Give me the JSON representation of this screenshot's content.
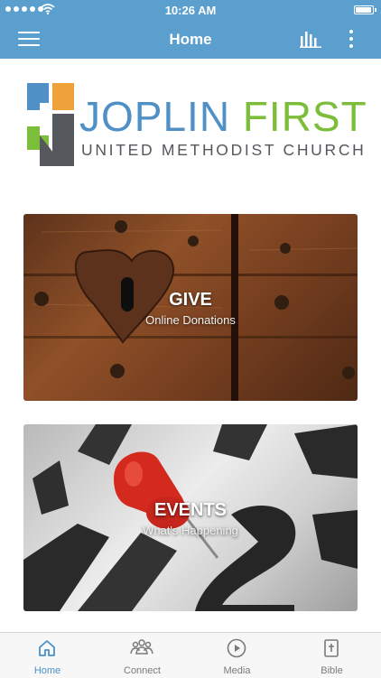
{
  "status_bar": {
    "time": "10:26 AM",
    "battery_level": 1.0
  },
  "header": {
    "title": "Home"
  },
  "logo": {
    "line1_a": "JOPLIN",
    "line1_b": "FIRST",
    "line2": "UNITED METHODIST CHURCH"
  },
  "cards": [
    {
      "title": "GIVE",
      "subtitle": "Online Donations"
    },
    {
      "title": "EVENTS",
      "subtitle": "What's Happening"
    }
  ],
  "tabs": [
    {
      "label": "Home",
      "icon": "home-icon",
      "active": true
    },
    {
      "label": "Connect",
      "icon": "people-icon",
      "active": false
    },
    {
      "label": "Media",
      "icon": "play-icon",
      "active": false
    },
    {
      "label": "Bible",
      "icon": "bible-icon",
      "active": false
    }
  ],
  "colors": {
    "brand_blue": "#5b9fcf",
    "logo_blue": "#4f90c7",
    "logo_green": "#7cbd3a",
    "tab_active": "#4a90c8"
  }
}
